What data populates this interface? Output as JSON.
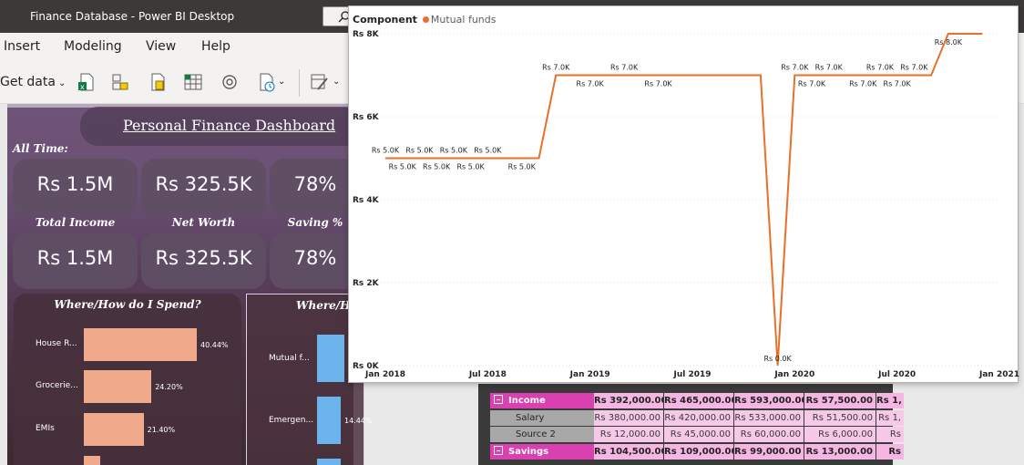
{
  "window": {
    "title": "Finance Database - Power BI Desktop"
  },
  "menu": [
    "Insert",
    "Modeling",
    "View",
    "Help"
  ],
  "ribbon": {
    "get_data_label": "Get data",
    "get_data_chevron": "⌄"
  },
  "dashboard": {
    "title": "Personal Finance Dashboard",
    "all_time_label": "All Time:",
    "kpis_row1": [
      "Rs 1.5M",
      "Rs 325.5K",
      "78%"
    ],
    "kpi_labels": [
      "Total Income",
      "Net Worth",
      "Saving %"
    ],
    "kpis_row2": [
      "Rs 1.5M",
      "Rs 325.5K",
      "78%"
    ],
    "spend_title": "Where/How do I Spend?",
    "spend_bars": [
      {
        "label": "House R...",
        "value": "40.44%",
        "pct": 40.44
      },
      {
        "label": "Grocerie...",
        "value": "24.20%",
        "pct": 24.2
      },
      {
        "label": "EMIs",
        "value": "21.40%",
        "pct": 21.4
      }
    ],
    "invest_title": "Where/He",
    "invest_bars": [
      {
        "label": "Mutual f...",
        "value": "",
        "pct": 30
      },
      {
        "label": "Emergen...",
        "value": "14.44%",
        "pct": 14.44
      }
    ]
  },
  "matrix": {
    "rows": [
      {
        "type": "head",
        "label": "Income",
        "values": [
          "Rs 392,000.00",
          "Rs 465,000.00",
          "Rs 593,000.00",
          "Rs 57,500.00",
          "Rs 1,"
        ]
      },
      {
        "type": "sub",
        "label": "Salary",
        "values": [
          "Rs 380,000.00",
          "Rs 420,000.00",
          "Rs 533,000.00",
          "Rs 51,500.00",
          "Rs 1,"
        ]
      },
      {
        "type": "sub",
        "label": "Source 2",
        "values": [
          "Rs 12,000.00",
          "Rs 45,000.00",
          "Rs 60,000.00",
          "Rs 6,000.00",
          "Rs"
        ]
      },
      {
        "type": "head",
        "label": "Savings",
        "values": [
          "Rs 104,500.00",
          "Rs 109,000.00",
          "Rs 99,000.00",
          "Rs 13,000.00",
          "Rs"
        ]
      }
    ]
  },
  "colors": {
    "line": "#e8702a",
    "accent_pink": "#d940b0",
    "spend_bar": "#f0a98a",
    "invest_bar": "#6cb4ee"
  },
  "icons": [
    "excel-icon",
    "dataflow-icon",
    "dataverse-icon",
    "table-icon",
    "refresh-icon",
    "recent-sources-icon",
    "transform-icon",
    "search-icon"
  ],
  "chart_data": {
    "type": "line",
    "legend_title": "Component",
    "series": [
      {
        "name": "Mutual funds",
        "points": [
          {
            "x": "2018-01",
            "y": 5000,
            "label": "Rs 5.0K"
          },
          {
            "x": "2018-02",
            "y": 5000,
            "label": "Rs 5.0K"
          },
          {
            "x": "2018-03",
            "y": 5000,
            "label": "Rs 5.0K"
          },
          {
            "x": "2018-04",
            "y": 5000,
            "label": "Rs 5.0K"
          },
          {
            "x": "2018-05",
            "y": 5000,
            "label": "Rs 5.0K"
          },
          {
            "x": "2018-06",
            "y": 5000,
            "label": "Rs 5.0K"
          },
          {
            "x": "2018-07",
            "y": 5000,
            "label": "Rs 5.0K"
          },
          {
            "x": "2018-09",
            "y": 5000,
            "label": "Rs 5.0K"
          },
          {
            "x": "2018-10",
            "y": 5000,
            "label": ""
          },
          {
            "x": "2018-11",
            "y": 7000,
            "label": "Rs 7.0K"
          },
          {
            "x": "2019-01",
            "y": 7000,
            "label": "Rs 7.0K"
          },
          {
            "x": "2019-03",
            "y": 7000,
            "label": "Rs 7.0K"
          },
          {
            "x": "2019-05",
            "y": 7000,
            "label": "Rs 7.0K"
          },
          {
            "x": "2019-06",
            "y": 7000,
            "label": ""
          },
          {
            "x": "2019-07",
            "y": 7000,
            "label": ""
          },
          {
            "x": "2019-08",
            "y": 7000,
            "label": ""
          },
          {
            "x": "2019-09",
            "y": 7000,
            "label": ""
          },
          {
            "x": "2019-10",
            "y": 7000,
            "label": ""
          },
          {
            "x": "2019-11",
            "y": 7000,
            "label": ""
          },
          {
            "x": "2019-12",
            "y": 0,
            "label": "Rs 0.0K"
          },
          {
            "x": "2020-01",
            "y": 7000,
            "label": "Rs 7.0K"
          },
          {
            "x": "2020-02",
            "y": 7000,
            "label": "Rs 7.0K"
          },
          {
            "x": "2020-03",
            "y": 7000,
            "label": "Rs 7.0K"
          },
          {
            "x": "2020-04",
            "y": 7000,
            "label": ""
          },
          {
            "x": "2020-05",
            "y": 7000,
            "label": "Rs 7.0K"
          },
          {
            "x": "2020-06",
            "y": 7000,
            "label": "Rs 7.0K"
          },
          {
            "x": "2020-07",
            "y": 7000,
            "label": "Rs 7.0K"
          },
          {
            "x": "2020-08",
            "y": 7000,
            "label": "Rs 7.0K"
          },
          {
            "x": "2020-09",
            "y": 7000,
            "label": ""
          },
          {
            "x": "2020-10",
            "y": 8000,
            "label": "Rs 8.0K"
          },
          {
            "x": "2020-12",
            "y": 8000,
            "label": ""
          }
        ]
      }
    ],
    "x_ticks": [
      {
        "x": "2018-01",
        "label": "Jan 2018"
      },
      {
        "x": "2018-07",
        "label": "Jul 2018"
      },
      {
        "x": "2019-01",
        "label": "Jan 2019"
      },
      {
        "x": "2019-07",
        "label": "Jul 2019"
      },
      {
        "x": "2020-01",
        "label": "Jan 2020"
      },
      {
        "x": "2020-07",
        "label": "Jul 2020"
      },
      {
        "x": "2021-01",
        "label": "Jan 2021"
      }
    ],
    "y_ticks": [
      {
        "value": 0,
        "label": "Rs 0K"
      },
      {
        "value": 2000,
        "label": "Rs 2K"
      },
      {
        "value": 4000,
        "label": "Rs 4K"
      },
      {
        "value": 6000,
        "label": "Rs 6K"
      },
      {
        "value": 8000,
        "label": "Rs 8K"
      }
    ],
    "xlim": [
      "2018-01",
      "2021-01"
    ],
    "ylim": [
      0,
      8000
    ],
    "grid": "horizontal-dotted",
    "legend_position": "top-left"
  }
}
